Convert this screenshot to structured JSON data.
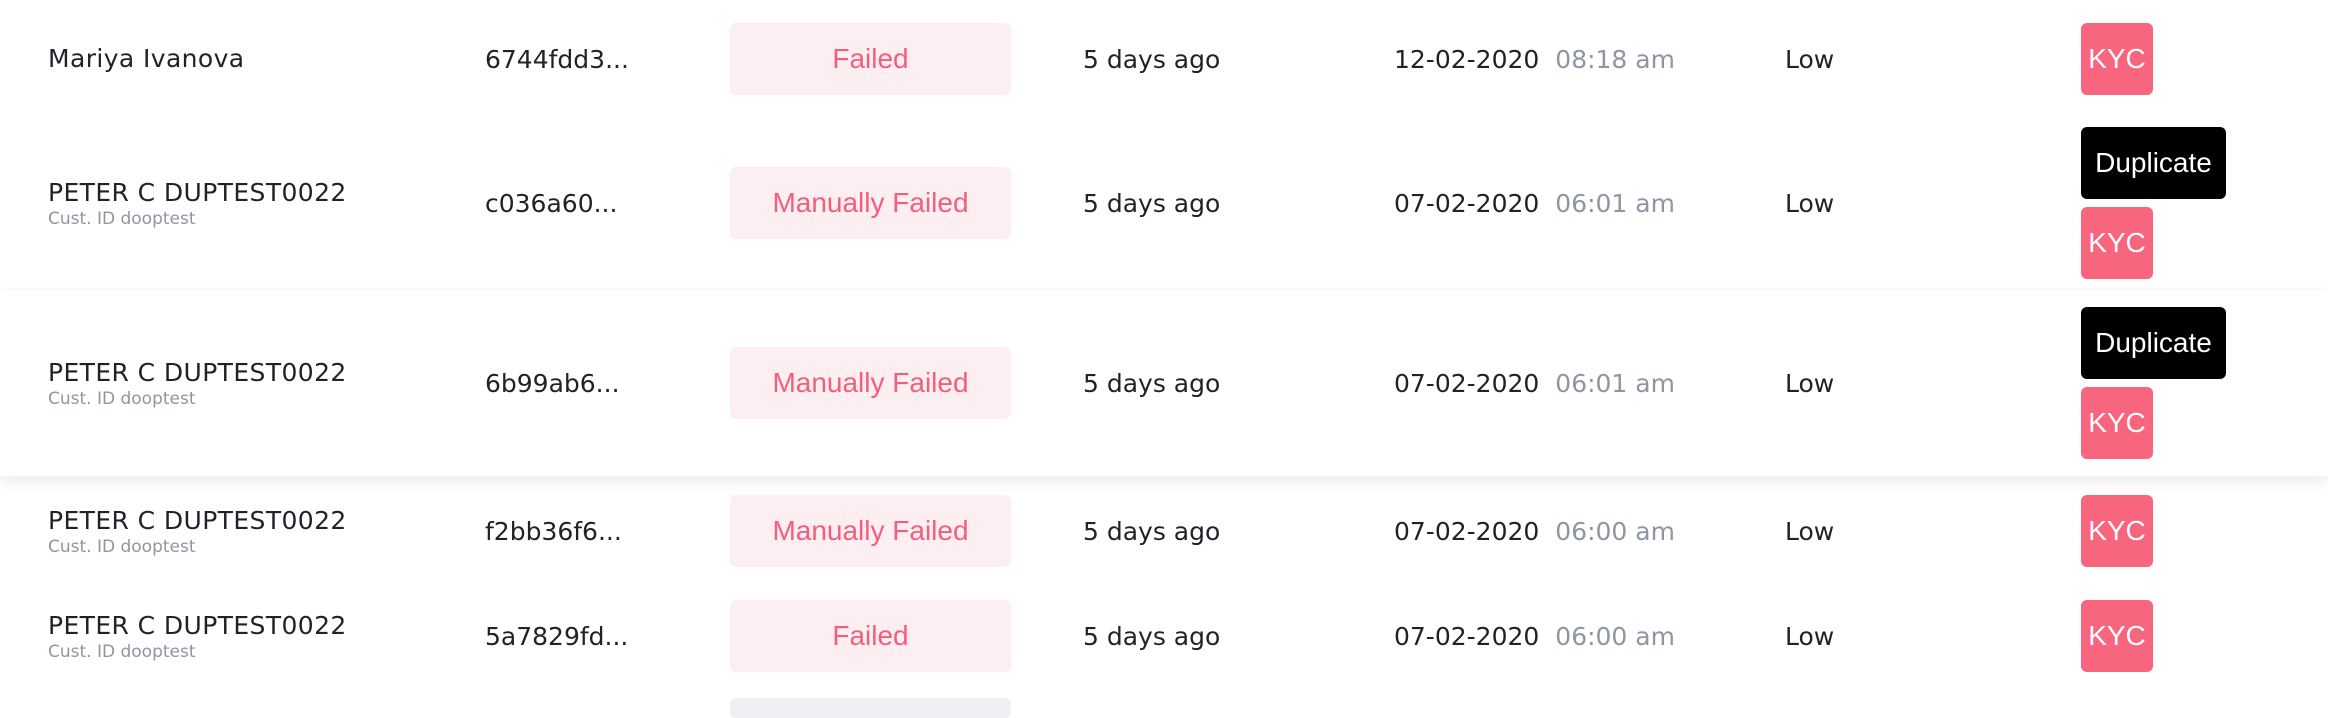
{
  "rows": [
    {
      "name": "Mariya Ivanova",
      "sub": "",
      "id": "6744fdd3...",
      "status": "Failed",
      "time": "5 days ago",
      "date": "12-02-2020",
      "clock": "08:18 am",
      "risk": "Low",
      "duplicate": "",
      "kyc": "KYC"
    },
    {
      "name": "PETER C DUPTEST0022",
      "sub": "Cust. ID dooptest",
      "id": "c036a60...",
      "status": "Manually Failed",
      "time": "5 days ago",
      "date": "07-02-2020",
      "clock": "06:01 am",
      "risk": "Low",
      "duplicate": "Duplicate",
      "kyc": "KYC"
    },
    {
      "name": "PETER C DUPTEST0022",
      "sub": "Cust. ID dooptest",
      "id": "6b99ab6...",
      "status": "Manually Failed",
      "time": "5 days ago",
      "date": "07-02-2020",
      "clock": "06:01 am",
      "risk": "Low",
      "duplicate": "Duplicate",
      "kyc": "KYC"
    },
    {
      "name": "PETER C DUPTEST0022",
      "sub": "Cust. ID dooptest",
      "id": "f2bb36f6...",
      "status": "Manually Failed",
      "time": "5 days ago",
      "date": "07-02-2020",
      "clock": "06:00 am",
      "risk": "Low",
      "duplicate": "",
      "kyc": "KYC"
    },
    {
      "name": "PETER C DUPTEST0022",
      "sub": "Cust. ID dooptest",
      "id": "5a7829fd...",
      "status": "Failed",
      "time": "5 days ago",
      "date": "07-02-2020",
      "clock": "06:00 am",
      "risk": "Low",
      "duplicate": "",
      "kyc": "KYC"
    }
  ],
  "colors": {
    "badge_bg": "#fdeef1",
    "badge_text": "#f25f7c",
    "kyc_bg": "#f7657f",
    "duplicate_bg": "#000000",
    "muted_text": "#8f96a3"
  }
}
